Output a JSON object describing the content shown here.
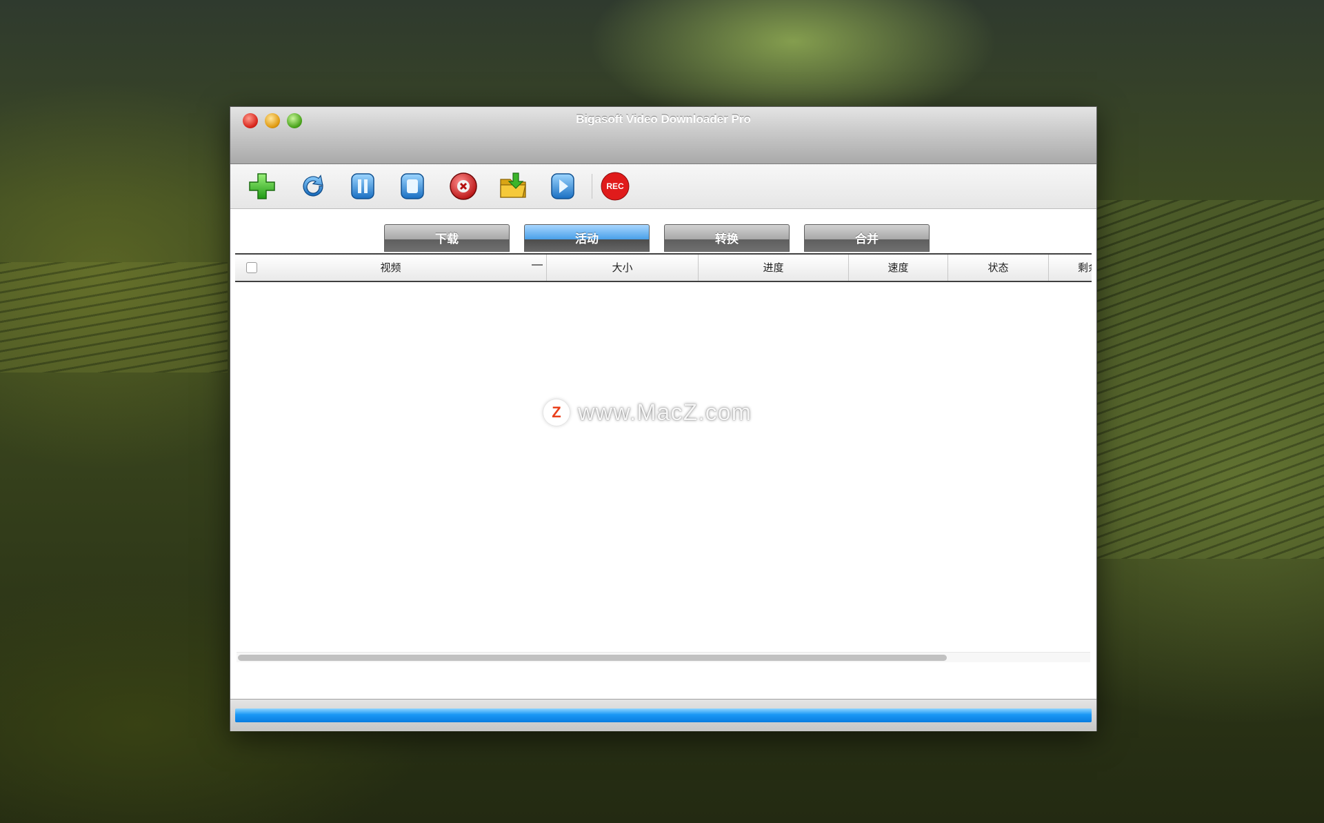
{
  "window": {
    "title": "Bigasoft Video Downloader Pro"
  },
  "toolbar": {
    "buttons": [
      {
        "name": "add-icon"
      },
      {
        "name": "refresh-icon"
      },
      {
        "name": "pause-icon"
      },
      {
        "name": "stop-icon"
      },
      {
        "name": "delete-icon"
      },
      {
        "name": "open-folder-icon"
      },
      {
        "name": "play-icon"
      },
      {
        "name": "rec-icon",
        "label": "REC"
      }
    ]
  },
  "tabs": [
    {
      "label": "下载",
      "active": false
    },
    {
      "label": "活动",
      "active": true
    },
    {
      "label": "转换",
      "active": false
    },
    {
      "label": "合并",
      "active": false
    }
  ],
  "table": {
    "columns": [
      "视频",
      "大小",
      "进度",
      "速度",
      "状态",
      "剩余"
    ],
    "rows": []
  },
  "progress": {
    "fraction": 1.0
  },
  "watermark": {
    "logo": "Z",
    "text": "www.MacZ.com"
  },
  "colors": {
    "accent": "#1a97f5",
    "rec": "#e01b1b"
  }
}
